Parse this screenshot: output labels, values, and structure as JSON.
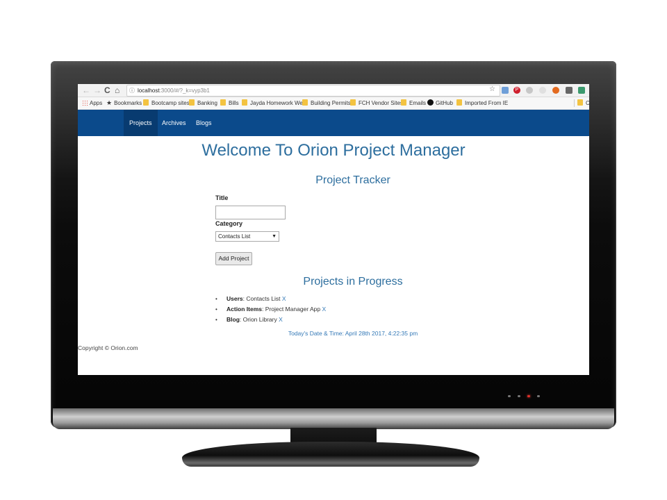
{
  "browser": {
    "url_host": "localhost",
    "url_path": ":3000/#/?_k=vyp3b1",
    "bookmarks": [
      "Apps",
      "Bookmarks",
      "Bootcamp sites",
      "Banking",
      "Bills",
      "Jayda Homework Wel",
      "Building Permits",
      "FCH Vendor Sites",
      "Emails",
      "GitHub",
      "Imported From IE",
      "C"
    ]
  },
  "nav": {
    "items": [
      "Projects",
      "Archives",
      "Blogs"
    ],
    "active": "Projects",
    "color": "#0b4a8b"
  },
  "page": {
    "heading": "Welcome To Orion Project Manager",
    "tracker_heading": "Project Tracker",
    "title_label": "Title",
    "title_value": "",
    "category_label": "Category",
    "category_value": "Contacts List",
    "add_button": "Add Project",
    "progress_heading": "Projects in Progress",
    "projects": [
      {
        "name": "Users",
        "category": ": Contacts List ",
        "delete": "X"
      },
      {
        "name": "Action Items",
        "category": ": Project Manager App ",
        "delete": "X"
      },
      {
        "name": "Blog",
        "category": ": Orion Library ",
        "delete": "X"
      }
    ],
    "datetime": "Today's Date & Time: April 28th 2017, 4:22:35 pm",
    "footer": "Copyright © Orion.com",
    "heading_color": "#2d6e9e",
    "link_color": "#3479b7"
  }
}
